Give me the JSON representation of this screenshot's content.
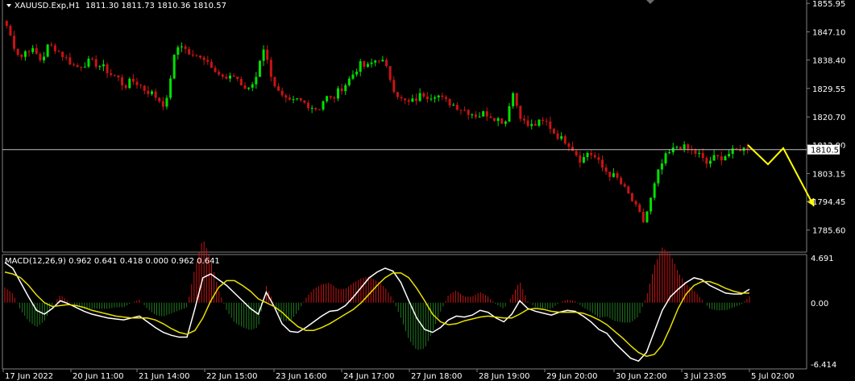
{
  "header": {
    "symbol_label": "XAUUSD.Exp,H1",
    "ohlc_label": "1811.30 1811.73 1810.36 1810.57"
  },
  "macd_header": {
    "label": "MACD(12,26,9) 0.962 0.641 0.418 0.000 0.962 0.641"
  },
  "colors": {
    "background": "#000000",
    "bull": "#00e000",
    "bear": "#c81414",
    "current_price_line": "#c0c0c0",
    "forecast_arrow": "#ffff00",
    "macd_main": "#ffffff",
    "macd_signal": "#e8e000",
    "grid": "#808080",
    "axis_text": "#ffffff"
  },
  "chart_data": [
    {
      "type": "candlestick",
      "title": "XAUUSD.Exp,H1",
      "y_ticks": [
        "1855.95",
        "1847.10",
        "1838.40",
        "1829.55",
        "1820.70",
        "1812.00",
        "1803.15",
        "1794.45",
        "1785.60"
      ],
      "ylim": [
        1782,
        1856
      ],
      "current_price": "1810.57",
      "x_ticks": [
        "17 Jun 2022",
        "20 Jun 11:00",
        "21 Jun 14:00",
        "22 Jun 15:00",
        "23 Jun 16:00",
        "24 Jun 17:00",
        "27 Jun 18:00",
        "28 Jun 19:00",
        "29 Jun 20:00",
        "30 Jun 22:00",
        "3 Jul 23:05",
        "5 Jul 02:00"
      ],
      "close_path": [
        1849,
        1843,
        1839,
        1842,
        1841,
        1838,
        1843,
        1842,
        1840,
        1838,
        1836,
        1837,
        1838,
        1837,
        1836,
        1834,
        1833,
        1830,
        1832,
        1831,
        1829,
        1828,
        1826,
        1824,
        1838,
        1844,
        1841,
        1839,
        1840,
        1838,
        1836,
        1833,
        1832,
        1834,
        1830,
        1829,
        1833,
        1843,
        1835,
        1829,
        1826,
        1825,
        1826,
        1825,
        1824,
        1823,
        1827,
        1826,
        1829,
        1831,
        1834,
        1837,
        1836,
        1838,
        1839,
        1835,
        1829,
        1826,
        1825,
        1826,
        1828,
        1827,
        1828,
        1826,
        1825,
        1824,
        1823,
        1822,
        1821,
        1822,
        1821,
        1820,
        1819,
        1829,
        1822,
        1818,
        1818,
        1819,
        1819,
        1816,
        1814,
        1813,
        1810,
        1807,
        1810,
        1808,
        1805,
        1803,
        1802,
        1799,
        1796,
        1792,
        1788,
        1795,
        1803,
        1808,
        1810,
        1812,
        1811,
        1810,
        1809,
        1806,
        1808,
        1808,
        1809,
        1810,
        1811,
        1810.57
      ],
      "forecast_path": [
        1812,
        1806,
        1811,
        1793
      ]
    },
    {
      "type": "macd",
      "title": "MACD(12,26,9)",
      "params": "12,26,9",
      "values_text": "0.962 0.641 0.418 0.000 0.962 0.641",
      "y_ticks": [
        "4.691",
        "0.00",
        "-6.414"
      ],
      "ylim": [
        -6.414,
        4.691
      ],
      "macd_line": [
        4.2,
        3.6,
        2.1,
        0.6,
        -0.8,
        -1.2,
        -0.6,
        0.2,
        -0.1,
        -0.5,
        -0.9,
        -1.2,
        -1.4,
        -1.6,
        -1.7,
        -1.8,
        -1.6,
        -1.4,
        -2.0,
        -2.6,
        -3.1,
        -3.4,
        -3.6,
        -3.6,
        -0.6,
        2.6,
        3.0,
        2.4,
        1.8,
        1.0,
        0.2,
        -0.6,
        -1.2,
        1.1,
        -0.4,
        -2.2,
        -3.0,
        -3.1,
        -2.6,
        -2.0,
        -1.4,
        -0.9,
        -0.8,
        -0.3,
        0.6,
        1.6,
        2.6,
        3.2,
        3.6,
        3.3,
        2.1,
        0.2,
        -1.6,
        -2.8,
        -3.1,
        -2.6,
        -1.8,
        -1.4,
        -1.5,
        -1.3,
        -0.8,
        -1.0,
        -1.6,
        -2.0,
        -1.2,
        0.2,
        -0.6,
        -0.9,
        -1.1,
        -1.3,
        -1.0,
        -0.8,
        -0.9,
        -1.4,
        -2.0,
        -2.8,
        -3.2,
        -4.2,
        -5.0,
        -5.8,
        -6.1,
        -5.2,
        -3.0,
        -0.8,
        0.6,
        1.4,
        2.1,
        2.6,
        2.4,
        1.8,
        1.4,
        1.0,
        0.9,
        0.9,
        1.4
      ],
      "signal_line": [
        3.2,
        3.0,
        2.6,
        1.8,
        0.8,
        0.0,
        -0.4,
        -0.3,
        -0.2,
        -0.3,
        -0.5,
        -0.8,
        -1.0,
        -1.2,
        -1.4,
        -1.5,
        -1.6,
        -1.6,
        -1.6,
        -1.8,
        -2.2,
        -2.7,
        -3.1,
        -3.3,
        -2.9,
        -1.6,
        0.2,
        1.6,
        2.3,
        2.3,
        1.8,
        1.2,
        0.4,
        0.0,
        -0.4,
        -1.0,
        -1.8,
        -2.5,
        -2.9,
        -2.9,
        -2.6,
        -2.2,
        -1.7,
        -1.2,
        -0.7,
        0.0,
        0.9,
        1.8,
        2.6,
        3.1,
        3.1,
        2.6,
        1.5,
        0.2,
        -1.2,
        -2.0,
        -2.3,
        -2.2,
        -1.9,
        -1.7,
        -1.5,
        -1.4,
        -1.5,
        -1.6,
        -1.6,
        -1.2,
        -0.7,
        -0.6,
        -0.7,
        -0.9,
        -1.0,
        -1.0,
        -1.0,
        -1.1,
        -1.4,
        -1.8,
        -2.3,
        -3.0,
        -3.7,
        -4.5,
        -5.2,
        -5.6,
        -5.4,
        -4.4,
        -2.6,
        -0.6,
        0.9,
        1.8,
        2.2,
        2.2,
        1.9,
        1.5,
        1.2,
        1.0,
        1.0
      ]
    }
  ]
}
